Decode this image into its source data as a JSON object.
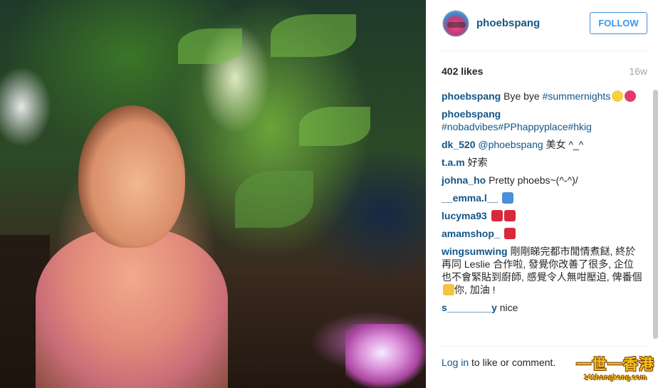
{
  "post": {
    "username": "phoebspang",
    "follow_label": "FOLLOW",
    "likes": "402 likes",
    "age": "16w"
  },
  "comments": [
    {
      "user": "phoebspang",
      "parts": [
        {
          "t": "text",
          "v": "Bye bye "
        },
        {
          "t": "link",
          "v": "#summernights"
        }
      ],
      "emoji": [
        "sparkles-icon",
        "hibiscus-icon"
      ]
    },
    {
      "user": "phoebspang",
      "parts": [
        {
          "t": "link",
          "v": "#nobadvibes"
        },
        {
          "t": "link",
          "v": "#PPhappyplace"
        },
        {
          "t": "link",
          "v": "#hkig"
        }
      ],
      "emoji": []
    },
    {
      "user": "dk_520",
      "parts": [
        {
          "t": "link",
          "v": "@phoebspang"
        },
        {
          "t": "text",
          "v": " 美女 ^_^"
        }
      ],
      "emoji": []
    },
    {
      "user": "t.a.m",
      "parts": [
        {
          "t": "text",
          "v": "好索"
        }
      ],
      "emoji": []
    },
    {
      "user": "johna_ho",
      "parts": [
        {
          "t": "text",
          "v": "Pretty phoebs~(^-^)/"
        }
      ],
      "emoji": []
    },
    {
      "user": "__emma.l__",
      "parts": [],
      "emoji": [
        "cool-icon"
      ]
    },
    {
      "user": "lucyma93",
      "parts": [],
      "emoji": [
        "dancer-icon",
        "dancer-icon"
      ]
    },
    {
      "user": "amamshop_",
      "parts": [],
      "emoji": [
        "hundred-points-icon"
      ]
    },
    {
      "user": "wingsumwing",
      "parts": [
        {
          "t": "text",
          "v": "剛剛睇完都市閒情煮餸, 終於再同 Leslie 合作啦, 發覺你改善了很多, 企位也不會緊貼到廚師, 感覺令人無咁壓迫, 俾番個"
        },
        {
          "t": "emoji",
          "v": "thumbs-up-icon"
        },
        {
          "t": "text",
          "v": "你, 加油 !"
        }
      ],
      "emoji": []
    },
    {
      "user": "s________y",
      "parts": [
        {
          "t": "text",
          "v": "nice"
        }
      ],
      "emoji": []
    }
  ],
  "footer": {
    "login_label": "Log in",
    "rest": " to like or comment."
  },
  "watermark": {
    "top": "一世一香港",
    "bottom": "141hongkong.com"
  },
  "emoji_colors": {
    "sparkles-icon": "#f5d142",
    "hibiscus-icon": "#e23b6a",
    "cool-icon": "#4a8fd9",
    "dancer-icon": "#d8283c",
    "hundred-points-icon": "#d8283c",
    "thumbs-up-icon": "#f5c242"
  }
}
